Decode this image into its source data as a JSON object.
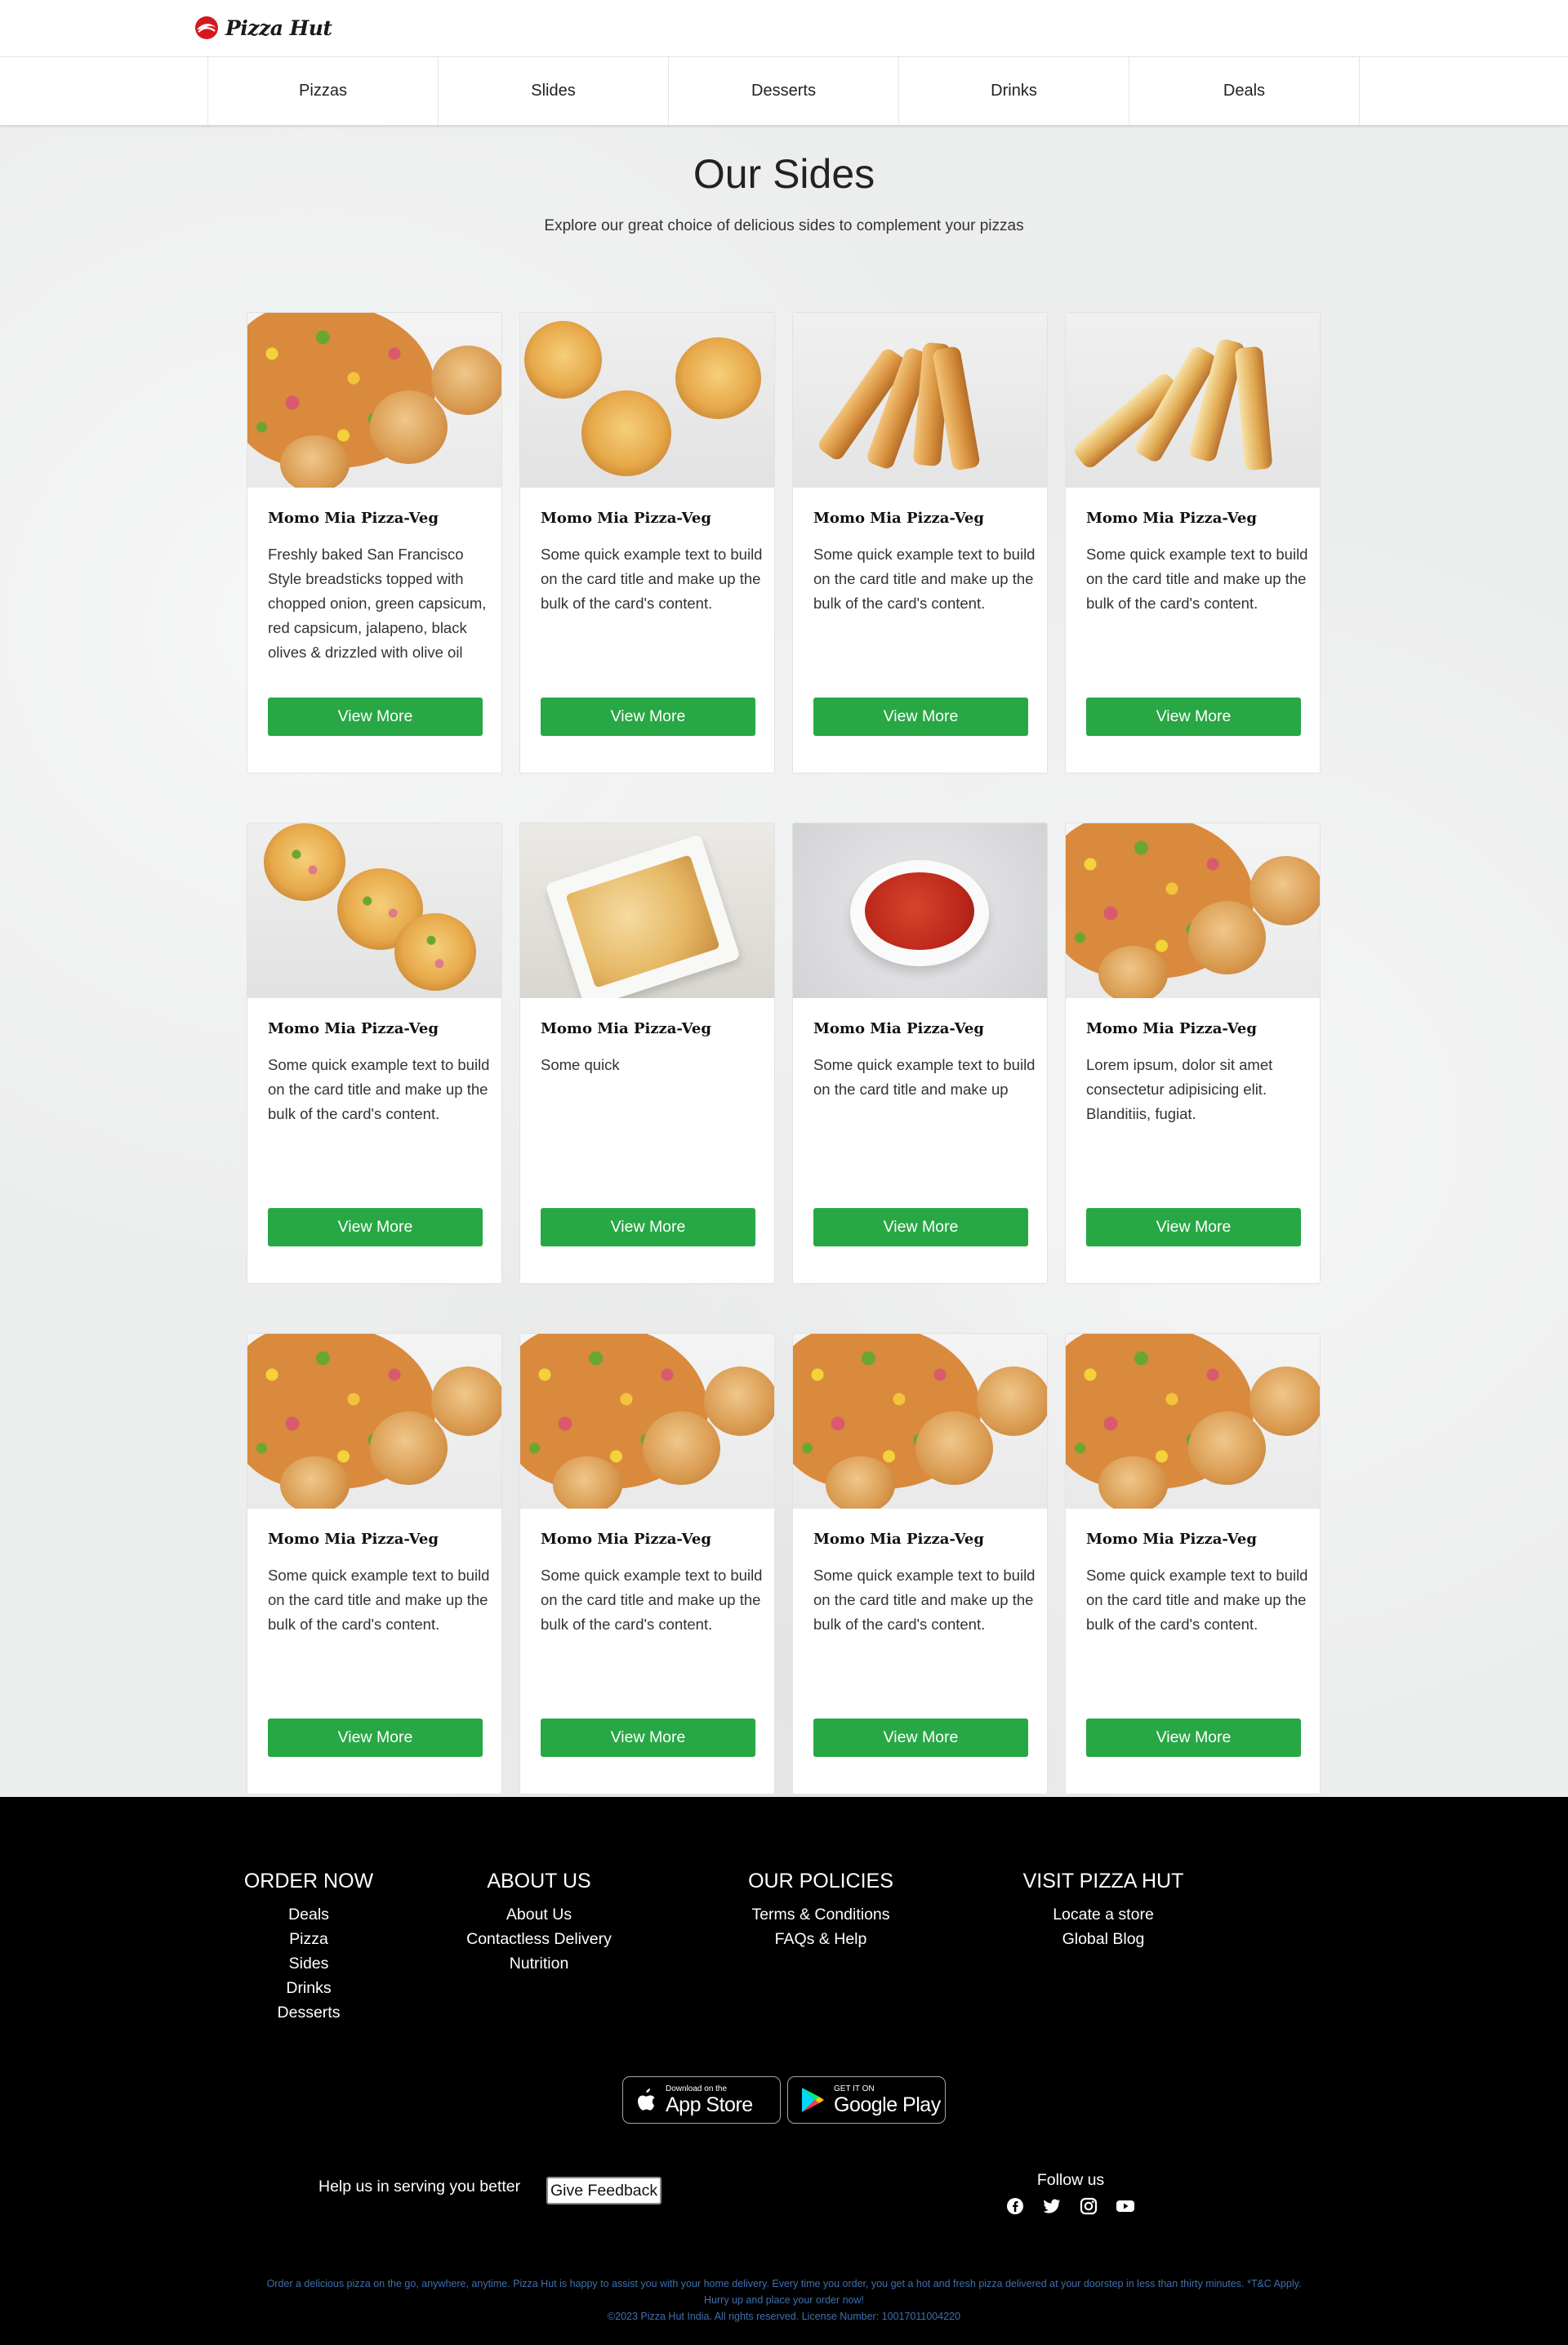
{
  "brand": {
    "name": "Pizza Hut",
    "accent": "#28a745",
    "logo_red": "#d6181d"
  },
  "nav": {
    "items": [
      "Pizzas",
      "Slides",
      "Desserts",
      "Drinks",
      "Deals"
    ]
  },
  "hero": {
    "title": "Our Sides",
    "subtitle": "Explore our great choice of delicious sides to complement your pizzas"
  },
  "cards": [
    {
      "image": "momo-pizza",
      "title": "Momo Mia Pizza-Veg",
      "text": "Freshly baked San Francisco Style breadsticks topped with chopped onion, green capsicum, red capsicum, jalapeno, black olives & drizzled with olive oil",
      "button": "View More"
    },
    {
      "image": "garlic-bread",
      "title": "Momo Mia Pizza-Veg",
      "text": "Some quick example text to build on the card title and make up the bulk of the card's content.",
      "button": "View More"
    },
    {
      "image": "breadsticks",
      "title": "Momo Mia Pizza-Veg",
      "text": "Some quick example text to build on the card title and make up the bulk of the card's content.",
      "button": "View More"
    },
    {
      "image": "breadsticks-cheese",
      "title": "Momo Mia Pizza-Veg",
      "text": "Some quick example text to build on the card title and make up the bulk of the card's content.",
      "button": "View More"
    },
    {
      "image": "topped-garlic-bread",
      "title": "Momo Mia Pizza-Veg",
      "text": "Some quick example text to build on the card title and make up the bulk of the card's content.",
      "button": "View More"
    },
    {
      "image": "cheesy-dish",
      "title": "Momo Mia Pizza-Veg",
      "text": "Some quick",
      "button": "View More"
    },
    {
      "image": "dip-bowl",
      "title": "Momo Mia Pizza-Veg",
      "text": "Some quick example text to build on the card title and make up",
      "button": "View More"
    },
    {
      "image": "momo-pizza",
      "title": "Momo Mia Pizza-Veg",
      "text": "Lorem ipsum, dolor sit amet consectetur adipisicing elit. Blanditiis, fugiat.",
      "button": "View More"
    },
    {
      "image": "momo-pizza",
      "title": "Momo Mia Pizza-Veg",
      "text": "Some quick example text to build on the card title and make up the bulk of the card's content.",
      "button": "View More"
    },
    {
      "image": "momo-pizza",
      "title": "Momo Mia Pizza-Veg",
      "text": "Some quick example text to build on the card title and make up the bulk of the card's content.",
      "button": "View More"
    },
    {
      "image": "momo-pizza",
      "title": "Momo Mia Pizza-Veg",
      "text": "Some quick example text to build on the card title and make up the bulk of the card's content.",
      "button": "View More"
    },
    {
      "image": "momo-pizza",
      "title": "Momo Mia Pizza-Veg",
      "text": "Some quick example text to build on the card title and make up the bulk of the card's content.",
      "button": "View More"
    }
  ],
  "footer": {
    "columns": [
      {
        "heading": "ORDER NOW",
        "links": [
          "Deals",
          "Pizza",
          "Sides",
          "Drinks",
          "Desserts"
        ]
      },
      {
        "heading": "ABOUT US",
        "links": [
          "About Us",
          "Contactless Delivery",
          "Nutrition"
        ]
      },
      {
        "heading": "OUR POLICIES",
        "links": [
          "Terms & Conditions",
          "FAQs & Help"
        ]
      },
      {
        "heading": "VISIT PIZZA HUT",
        "links": [
          "Locate a store",
          "Global Blog"
        ]
      }
    ],
    "app_store": {
      "small": "Download on the",
      "large": "App Store"
    },
    "google_play": {
      "small": "GET IT ON",
      "large": "Google Play"
    },
    "help_text": "Help us in serving you better",
    "feedback_button": "Give Feedback",
    "follow_text": "Follow us",
    "socials": [
      "facebook-icon",
      "twitter-icon",
      "instagram-icon",
      "youtube-icon"
    ],
    "legal": [
      "Order a delicious pizza on the go, anywhere, anytime. Pizza Hut is happy to assist you with your home delivery. Every time you order, you get a hot and fresh pizza delivered at your doorstep in less than thirty minutes. *T&C Apply.",
      "Hurry up and place your order now!",
      "©2023 Pizza Hut India. All rights reserved. License Number: 10017011004220"
    ]
  }
}
